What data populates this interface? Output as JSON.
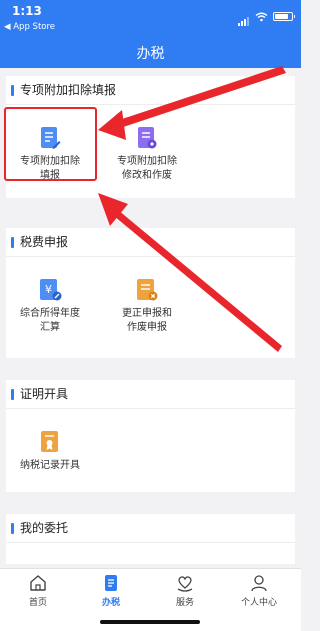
{
  "status": {
    "time": "1:13",
    "back_label": "◀ App Store"
  },
  "header": {
    "title": "办税"
  },
  "sections": [
    {
      "title": "专项附加扣除填报",
      "items": [
        {
          "line1": "专项附加扣除",
          "line2": "填报",
          "icon": "doc-edit-icon"
        },
        {
          "line1": "专项附加扣除",
          "line2": "修改和作废",
          "icon": "doc-gear-icon"
        }
      ]
    },
    {
      "title": "税费申报",
      "items": [
        {
          "line1": "综合所得年度",
          "line2": "汇算",
          "icon": "tax-yen-icon"
        },
        {
          "line1": "更正申报和",
          "line2": "作废申报",
          "icon": "doc-cancel-icon"
        }
      ]
    },
    {
      "title": "证明开具",
      "items": [
        {
          "line1": "纳税记录开具",
          "line2": "",
          "icon": "certificate-icon"
        }
      ]
    },
    {
      "title": "我的委托",
      "items": []
    }
  ],
  "nav": {
    "items": [
      {
        "label": "首页",
        "icon": "home-icon"
      },
      {
        "label": "办税",
        "icon": "tax-doc-icon",
        "active": true
      },
      {
        "label": "服务",
        "icon": "heart-hand-icon"
      },
      {
        "label": "个人中心",
        "icon": "person-icon"
      }
    ]
  },
  "colors": {
    "brand": "#2f7cf3",
    "highlight": "#e8262b",
    "icon_purple": "#8d6df0",
    "icon_orange": "#f0a23c"
  }
}
